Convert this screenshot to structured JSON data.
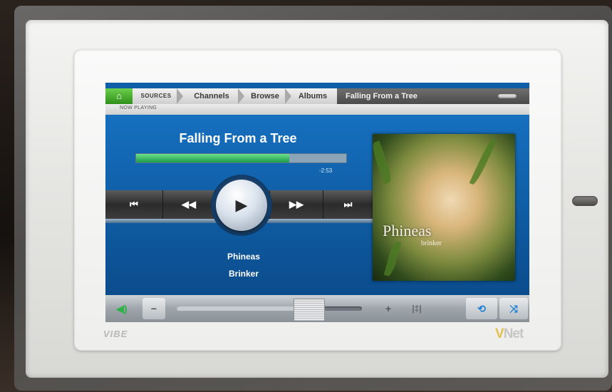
{
  "device": {
    "brand_left": "VIBE",
    "brand_right_prefix": "V",
    "brand_right_suffix": "Net"
  },
  "breadcrumb": {
    "home_icon": "home-icon",
    "items": [
      "SOURCES",
      "Channels",
      "Browse",
      "Albums"
    ],
    "current": "Falling From a Tree"
  },
  "subheader": {
    "label": "NOW PLAYING"
  },
  "now_playing": {
    "title": "Falling From a Tree",
    "time_remaining": "-2:53",
    "progress_fraction": 0.73,
    "artist": "Phineas",
    "album": "Brinker",
    "album_art": {
      "line1": "Phineas",
      "line2": "brinker"
    }
  },
  "transport": {
    "previous_track": "⏮",
    "rewind": "◀◀",
    "play": "▶",
    "fast_forward": "▶▶",
    "next_track": "⏭"
  },
  "volume": {
    "speaker_icon": "speaker-icon",
    "minus": "−",
    "plus": "+",
    "level_fraction": 0.71,
    "eq_icon": "equalizer-icon",
    "repeat_icon": "repeat-icon",
    "shuffle_icon": "shuffle-icon"
  },
  "colors": {
    "accent_green": "#2f8f1a",
    "screen_blue": "#0e5fa8",
    "progress_green": "#1c9a4a",
    "repeat_blue": "#1c7ed6"
  }
}
